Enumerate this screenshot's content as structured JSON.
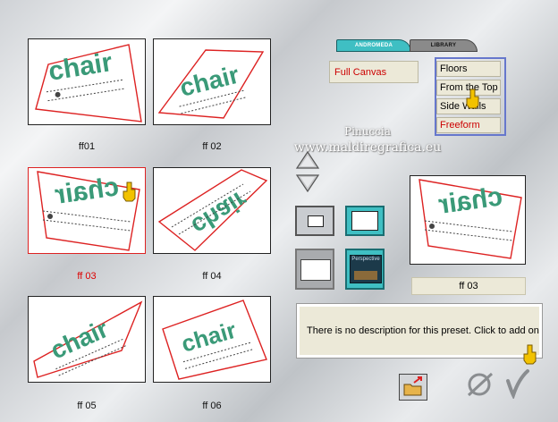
{
  "tabs": [
    {
      "label": "ANDROMEDA"
    },
    {
      "label": "LIBRARY"
    }
  ],
  "presets": [
    {
      "caption": "ff01",
      "text": "chair",
      "selected": false
    },
    {
      "caption": "ff 02",
      "text": "chair",
      "selected": false
    },
    {
      "caption": "ff 03",
      "text": "chair",
      "selected": true
    },
    {
      "caption": "ff 04",
      "text": "chair",
      "selected": false
    },
    {
      "caption": "ff 05",
      "text": "chair",
      "selected": false
    },
    {
      "caption": "ff 06",
      "text": "chair",
      "selected": false
    }
  ],
  "mode_field": {
    "value": "Full Canvas"
  },
  "categories": [
    "Floors",
    "From the Top",
    "Side Walls",
    "Freeform"
  ],
  "watermark": {
    "line1": "Pinuccia",
    "line2": "www.maldiregrafica.eu"
  },
  "preview": {
    "text": "chair",
    "name": "ff 03"
  },
  "view_thumb_label": "Perspective",
  "description": "There is no description for this preset. Click to add one",
  "colors": {
    "accent_tab": "#3fbfc3",
    "selected": "#dd0000",
    "chair_green": "#3a9a78"
  }
}
